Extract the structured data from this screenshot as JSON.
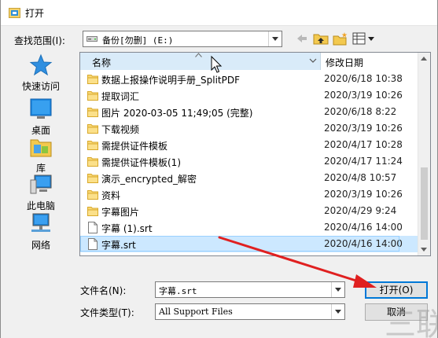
{
  "window": {
    "title": "打开"
  },
  "toolbar": {
    "look_in_label": "查找范围(I):",
    "look_in_value": "备份[勿删] (E:)"
  },
  "places": [
    {
      "label": "快速访问",
      "icon": "star-icon"
    },
    {
      "label": "桌面",
      "icon": "desktop-icon"
    },
    {
      "label": "库",
      "icon": "library-icon"
    },
    {
      "label": "此电脑",
      "icon": "computer-icon"
    },
    {
      "label": "网络",
      "icon": "network-icon"
    }
  ],
  "list": {
    "col_name": "名称",
    "col_date": "修改日期",
    "rows": [
      {
        "name": "数据上报操作说明手册_SplitPDF",
        "date": "2020/6/18 10:38",
        "type": "folder"
      },
      {
        "name": "提取词汇",
        "date": "2020/3/19 10:26",
        "type": "folder"
      },
      {
        "name": "图片 2020-03-05 11;49;05 (完整)",
        "date": "2020/6/18 8:22",
        "type": "folder"
      },
      {
        "name": "下载视频",
        "date": "2020/3/19 10:26",
        "type": "folder"
      },
      {
        "name": "需提供证件模板",
        "date": "2020/4/17 10:28",
        "type": "folder"
      },
      {
        "name": "需提供证件模板(1)",
        "date": "2020/4/17 11:24",
        "type": "folder"
      },
      {
        "name": "演示_encrypted_解密",
        "date": "2020/4/8 10:57",
        "type": "folder"
      },
      {
        "name": "资料",
        "date": "2020/3/19 10:26",
        "type": "folder"
      },
      {
        "name": "字幕图片",
        "date": "2020/4/29 9:24",
        "type": "folder"
      },
      {
        "name": "字幕 (1).srt",
        "date": "2020/4/16 14:00",
        "type": "file"
      },
      {
        "name": "字幕.srt",
        "date": "2020/4/16 14:00",
        "type": "file",
        "selected": true
      }
    ]
  },
  "bottom": {
    "filename_label": "文件名(N):",
    "filename_value": "字幕.srt",
    "filetype_label": "文件类型(T):",
    "filetype_value": "All Support Files",
    "open_button": "打开(O)",
    "cancel_button": "取消"
  },
  "watermark": {
    "text": "三联"
  },
  "colors": {
    "selection": "#cce8ff",
    "header_highlight": "#d9ebf9",
    "folder": "#f8d775",
    "annotation_arrow": "#e02020",
    "default_button_border": "#0078d7"
  }
}
